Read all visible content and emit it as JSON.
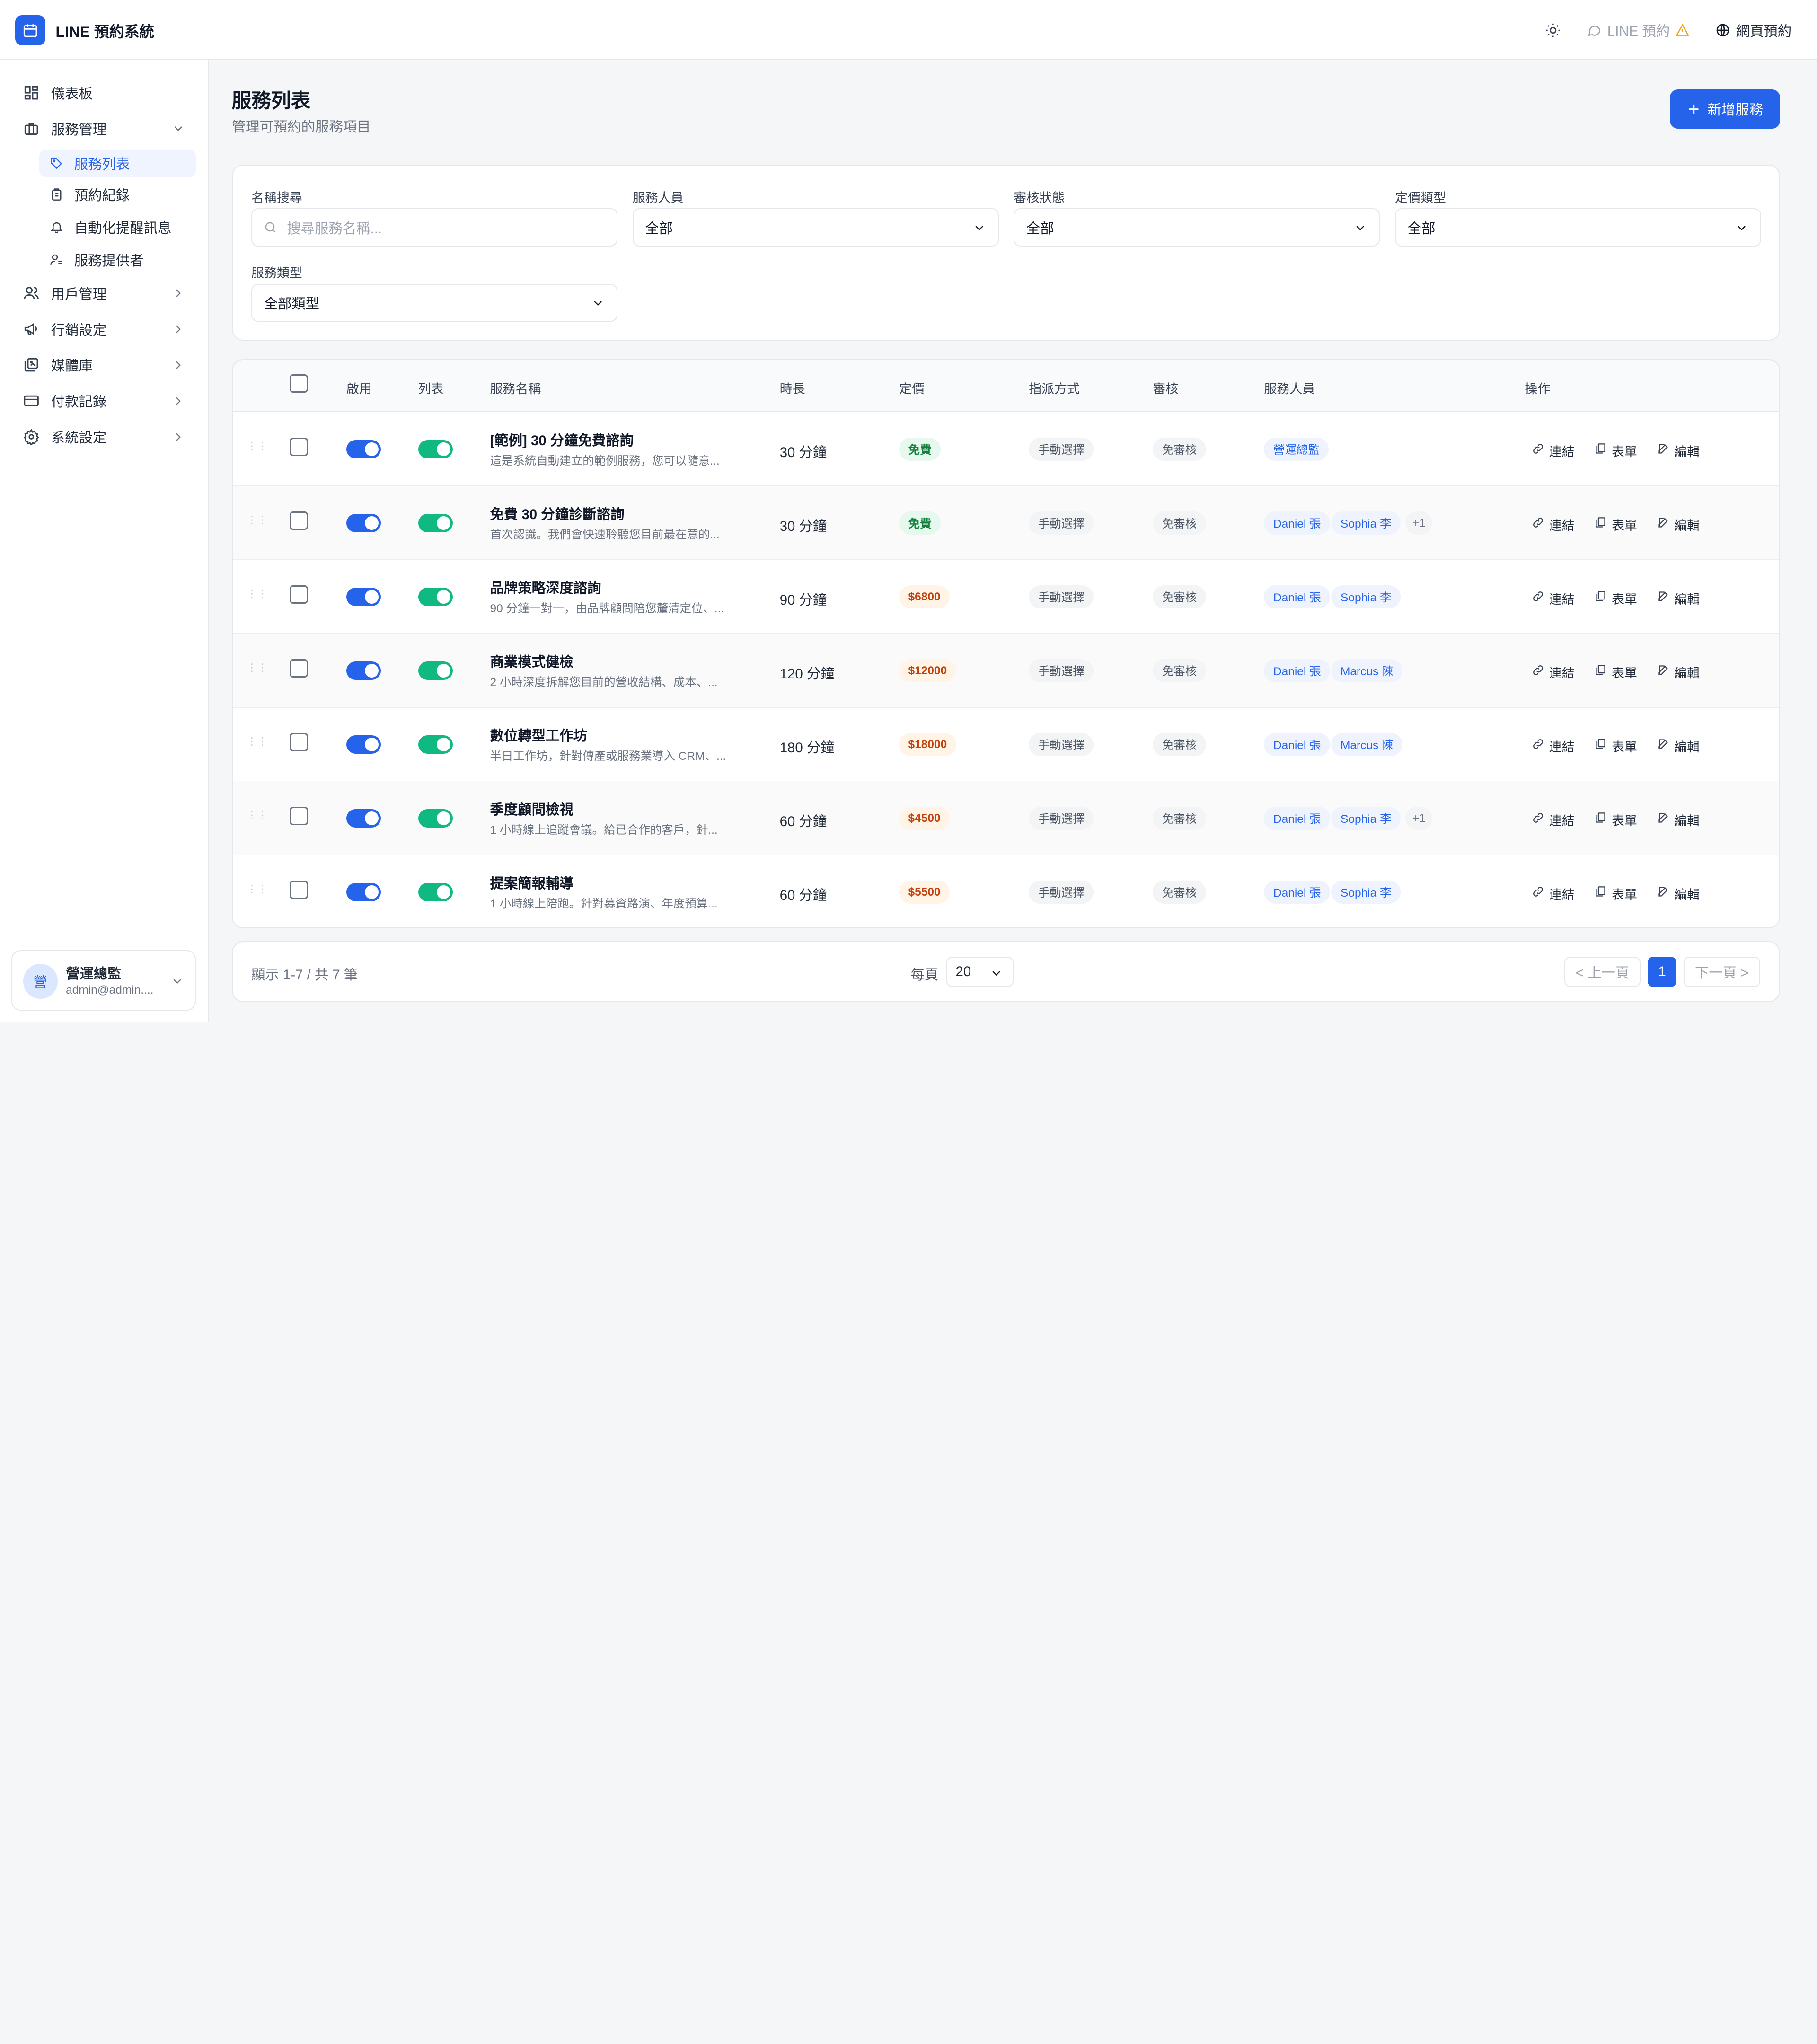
{
  "app": {
    "title": "LINE 預約系統"
  },
  "topbar": {
    "line_label": "LINE 預約",
    "web_label": "網頁預約"
  },
  "sidebar": {
    "items": [
      {
        "label": "儀表板",
        "icon": "dashboard-icon"
      },
      {
        "label": "服務管理",
        "icon": "briefcase-icon"
      },
      {
        "label": "用戶管理",
        "icon": "users-icon"
      },
      {
        "label": "行銷設定",
        "icon": "megaphone-icon"
      },
      {
        "label": "媒體庫",
        "icon": "gallery-icon"
      },
      {
        "label": "付款記錄",
        "icon": "credit-card-icon"
      },
      {
        "label": "系統設定",
        "icon": "gear-icon"
      }
    ],
    "sub_items": [
      {
        "label": "服務列表",
        "icon": "tag-icon"
      },
      {
        "label": "預約紀錄",
        "icon": "clipboard-icon"
      },
      {
        "label": "自動化提醒訊息",
        "icon": "bell-icon"
      },
      {
        "label": "服務提供者",
        "icon": "provider-icon"
      }
    ],
    "user": {
      "avatar": "營",
      "name": "營運總監",
      "email": "admin@admin...."
    }
  },
  "page": {
    "title": "服務列表",
    "subtitle": "管理可預約的服務項目",
    "add_button": "新增服務"
  },
  "filters": {
    "name_label": "名稱搜尋",
    "name_placeholder": "搜尋服務名稱...",
    "staff_label": "服務人員",
    "staff_value": "全部",
    "review_label": "審核狀態",
    "review_value": "全部",
    "pricing_label": "定價類型",
    "pricing_value": "全部",
    "type_label": "服務類型",
    "type_value": "全部類型"
  },
  "table": {
    "headers": {
      "enabled": "啟用",
      "listed": "列表",
      "name": "服務名稱",
      "duration": "時長",
      "price": "定價",
      "assign": "指派方式",
      "review": "審核",
      "staff": "服務人員",
      "actions": "操作"
    },
    "action_labels": {
      "link": "連結",
      "form": "表單",
      "edit": "編輯"
    },
    "rows": [
      {
        "name": "[範例] 30 分鐘免費諮詢",
        "desc": "這是系統自動建立的範例服務，您可以隨意...",
        "duration": "30 分鐘",
        "price": "免費",
        "free": true,
        "assign": "手動選擇",
        "review": "免審核",
        "staff": [
          "營運總監"
        ],
        "more": ""
      },
      {
        "name": "免費 30 分鐘診斷諮詢",
        "desc": "首次認識。我們會快速聆聽您目前最在意的...",
        "duration": "30 分鐘",
        "price": "免費",
        "free": true,
        "assign": "手動選擇",
        "review": "免審核",
        "staff": [
          "Daniel 張",
          "Sophia 李"
        ],
        "more": "+1"
      },
      {
        "name": "品牌策略深度諮詢",
        "desc": "90 分鐘一對一，由品牌顧問陪您釐清定位、...",
        "duration": "90 分鐘",
        "price": "$6800",
        "free": false,
        "assign": "手動選擇",
        "review": "免審核",
        "staff": [
          "Daniel 張",
          "Sophia 李"
        ],
        "more": ""
      },
      {
        "name": "商業模式健檢",
        "desc": "2 小時深度拆解您目前的營收結構、成本、...",
        "duration": "120 分鐘",
        "price": "$12000",
        "free": false,
        "assign": "手動選擇",
        "review": "免審核",
        "staff": [
          "Daniel 張",
          "Marcus 陳"
        ],
        "more": ""
      },
      {
        "name": "數位轉型工作坊",
        "desc": "半日工作坊，針對傳產或服務業導入 CRM、...",
        "duration": "180 分鐘",
        "price": "$18000",
        "free": false,
        "assign": "手動選擇",
        "review": "免審核",
        "staff": [
          "Daniel 張",
          "Marcus 陳"
        ],
        "more": ""
      },
      {
        "name": "季度顧問檢視",
        "desc": "1 小時線上追蹤會議。給已合作的客戶，針...",
        "duration": "60 分鐘",
        "price": "$4500",
        "free": false,
        "assign": "手動選擇",
        "review": "免審核",
        "staff": [
          "Daniel 張",
          "Sophia 李"
        ],
        "more": "+1"
      },
      {
        "name": "提案簡報輔導",
        "desc": "1 小時線上陪跑。針對募資路演、年度預算...",
        "duration": "60 分鐘",
        "price": "$5500",
        "free": false,
        "assign": "手動選擇",
        "review": "免審核",
        "staff": [
          "Daniel 張",
          "Sophia 李"
        ],
        "more": ""
      }
    ]
  },
  "pagination": {
    "info": "顯示 1-7 / 共 7 筆",
    "per_page_label": "每頁",
    "per_page_value": "20",
    "prev": "< 上一頁",
    "current": "1",
    "next": "下一頁 >"
  },
  "colors": {
    "accent": "#2563eb",
    "toggle_on": "#10b981"
  }
}
